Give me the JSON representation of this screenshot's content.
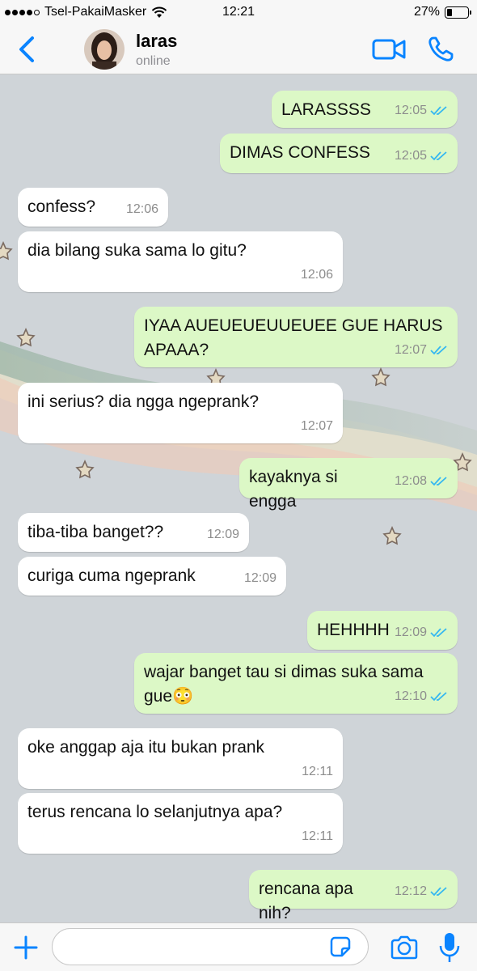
{
  "status_bar": {
    "carrier": "Tsel-PakaiMasker",
    "time": "12:21",
    "battery": "27%",
    "battery_level": 0.27
  },
  "header": {
    "contact_name": "laras",
    "contact_status": "online"
  },
  "messages": [
    {
      "dir": "out",
      "text": "LARASSSS",
      "time": "12:05",
      "read": true
    },
    {
      "dir": "out",
      "text": "DIMAS CONFESS",
      "time": "12:05",
      "read": true
    },
    {
      "dir": "in",
      "text": "confess?",
      "time": "12:06"
    },
    {
      "dir": "in",
      "text": "dia bilang suka sama lo gitu?",
      "time": "12:06"
    },
    {
      "dir": "out",
      "text": "IYAA AUEUEUEUUEUEE GUE HARUS APAAA?",
      "time": "12:07",
      "read": true
    },
    {
      "dir": "in",
      "text": "ini serius? dia ngga ngeprank?",
      "time": "12:07"
    },
    {
      "dir": "out",
      "text": "kayaknya si engga",
      "time": "12:08",
      "read": true
    },
    {
      "dir": "in",
      "text": "tiba-tiba banget??",
      "time": "12:09"
    },
    {
      "dir": "in",
      "text": "curiga cuma ngeprank",
      "time": "12:09"
    },
    {
      "dir": "out",
      "text": "HEHHHH",
      "time": "12:09",
      "read": true
    },
    {
      "dir": "out",
      "text": "wajar banget tau si dimas suka sama gue😳",
      "time": "12:10",
      "read": true
    },
    {
      "dir": "in",
      "text": "oke anggap aja itu bukan prank",
      "time": "12:11"
    },
    {
      "dir": "in",
      "text": "terus rencana lo selanjutnya apa?",
      "time": "12:11"
    },
    {
      "dir": "out",
      "text": "rencana apa nih?",
      "time": "12:12",
      "read": true
    }
  ],
  "input": {
    "value": "",
    "placeholder": ""
  },
  "icons": {
    "back": "chevron-left-icon",
    "video": "video-camera-icon",
    "phone": "phone-icon",
    "plus": "plus-icon",
    "sticker": "sticker-icon",
    "camera": "camera-icon",
    "mic": "microphone-icon"
  },
  "colors": {
    "accent": "#0a84ff",
    "outgoing_bubble": "#dcf8c6",
    "incoming_bubble": "#ffffff",
    "read_ticks": "#34b7f1",
    "chat_background": "#cfd4d8"
  }
}
